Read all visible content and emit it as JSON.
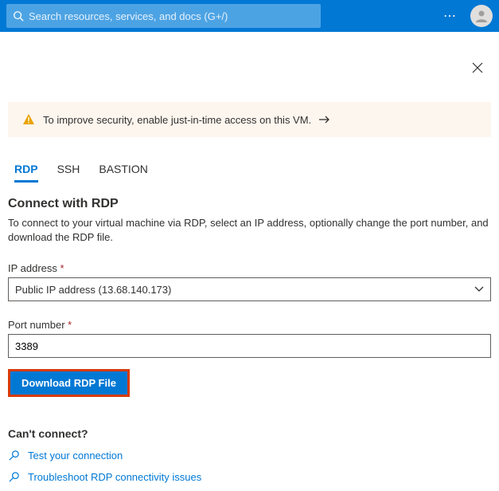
{
  "search": {
    "placeholder": "Search resources, services, and docs (G+/)"
  },
  "banner": {
    "message": "To improve security, enable just-in-time access on this VM."
  },
  "tabs": {
    "rdp": "RDP",
    "ssh": "SSH",
    "bastion": "BASTION"
  },
  "main": {
    "title": "Connect with RDP",
    "description": "To connect to your virtual machine via RDP, select an IP address, optionally change the port number, and download the RDP file.",
    "ip_label": "IP address",
    "ip_value": "Public IP address (13.68.140.173)",
    "port_label": "Port number",
    "port_value": "3389",
    "download_btn": "Download RDP File"
  },
  "help": {
    "heading": "Can't connect?",
    "test_link": "Test your connection",
    "troubleshoot_link": "Troubleshoot RDP connectivity issues"
  }
}
